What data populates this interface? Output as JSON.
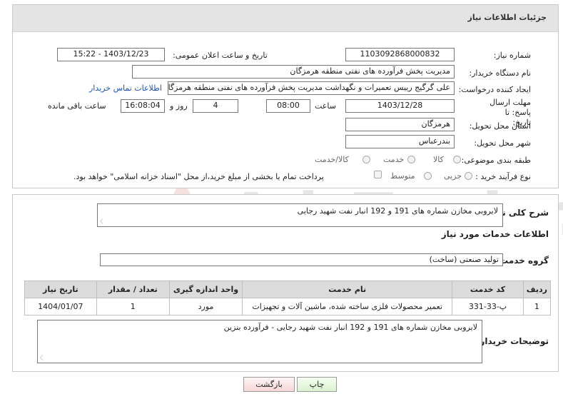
{
  "header": {
    "title": "جزئیات اطلاعات نیاز"
  },
  "need_number": {
    "label": "شماره نیاز:",
    "value": "1103092868000832"
  },
  "announce": {
    "label": "تاریخ و ساعت اعلان عمومی:",
    "value": "1403/12/23 - 15:22"
  },
  "buyer": {
    "label": "نام دستگاه خریدار:",
    "value": "مدیریت پخش فرآورده های نفتی منطقه هرمزگان"
  },
  "creator": {
    "label": "ایجاد کننده درخواست:",
    "value": "علی گرگیج رییس تعمیرات و نگهداشت مدیریت پخش فرآورده های نفتی منطقه هرمزگان",
    "contact_link": "اطلاعات تماس خریدار"
  },
  "deadline": {
    "label": "مهلت ارسال پاسخ: تا تاریخ:",
    "date": "1403/12/28",
    "time_label": "ساعت",
    "time": "08:00",
    "days": "4",
    "days_label": "روز و",
    "remaining": "16:08:04",
    "remaining_label": "ساعت باقی مانده"
  },
  "province": {
    "label": "استان محل تحویل:",
    "value": "هرمزگان"
  },
  "city": {
    "label": "شهر محل تحویل:",
    "value": "بندرعباس"
  },
  "category": {
    "label": "طبقه بندی موضوعی:",
    "options": [
      "کالا",
      "خدمت",
      "کالا/خدمت"
    ]
  },
  "process": {
    "label": "نوع فرآیند خرید :",
    "options": [
      "جزیی",
      "متوسط"
    ],
    "payment_note": "پرداخت تمام یا بخشی از مبلغ خرید،از محل \"اسناد خزانه اسلامی\" خواهد بود."
  },
  "summary": {
    "label": "شرح کلی نیاز:",
    "value": "لایروبی مخازن شماره های 191 و 192 انبار نفت شهید رجایی"
  },
  "services_info": {
    "title": "اطلاعات خدمات مورد نیاز"
  },
  "service_group": {
    "label": "گروه خدمت:",
    "value": "تولید صنعتی (ساخت)"
  },
  "table": {
    "headers": [
      "ردیف",
      "کد خدمت",
      "نام خدمت",
      "واحد اندازه گیری",
      "تعداد / مقدار",
      "تاریخ نیاز"
    ],
    "rows": [
      [
        "1",
        "پ-33-331",
        "تعمیر محصولات فلزی ساخته شده، ماشین آلات و تجهیزات",
        "مورد",
        "1",
        "1404/01/07"
      ]
    ]
  },
  "buyer_notes": {
    "label": "توضیحات خریدار:",
    "value": "لایروبی مخازن شماره های 191 و 192 انبار نفت شهید رجایی - فرآورده بنزین"
  },
  "buttons": {
    "print": "چاپ",
    "back": "بازگشت"
  },
  "watermark": {
    "text": "AriaTender.neT",
    "subtext": "ARIA TENDER PORTAL"
  }
}
